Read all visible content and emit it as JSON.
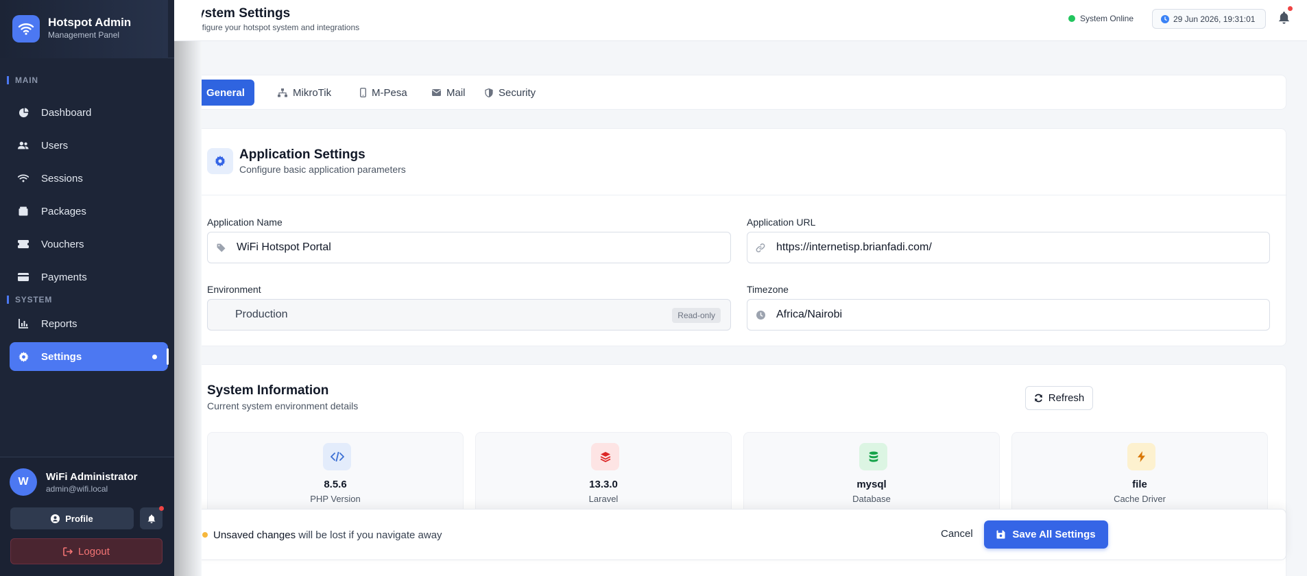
{
  "brand": {
    "title": "Hotspot Admin",
    "subtitle": "Management Panel"
  },
  "sidebar": {
    "sections": {
      "main": "MAIN",
      "system": "SYSTEM"
    },
    "items": [
      {
        "label": "Dashboard",
        "icon": "dashboard-icon"
      },
      {
        "label": "Users",
        "icon": "users-icon"
      },
      {
        "label": "Sessions",
        "icon": "wifi-icon"
      },
      {
        "label": "Packages",
        "icon": "box-icon"
      },
      {
        "label": "Vouchers",
        "icon": "ticket-icon"
      },
      {
        "label": "Payments",
        "icon": "credit-card-icon"
      },
      {
        "label": "Reports",
        "icon": "chart-icon"
      },
      {
        "label": "Settings",
        "icon": "gear-icon",
        "active": true
      }
    ]
  },
  "user": {
    "initial": "W",
    "name": "WiFi Administrator",
    "email": "admin@wifi.local",
    "profile_label": "Profile",
    "logout_label": "Logout"
  },
  "header": {
    "title": "ystem Settings",
    "subtitle": "nfigure your hotspot system and integrations",
    "status": "System Online",
    "datetime": "29 Jun 2026, 19:31:01"
  },
  "tabs": [
    {
      "label": "General",
      "active": true
    },
    {
      "label": "MikroTik"
    },
    {
      "label": "M-Pesa"
    },
    {
      "label": "Mail"
    },
    {
      "label": "Security"
    }
  ],
  "app_settings": {
    "title": "Application Settings",
    "subtitle": "Configure basic application parameters",
    "fields": {
      "app_name": {
        "label": "Application Name",
        "value": "WiFi Hotspot Portal"
      },
      "app_url": {
        "label": "Application URL",
        "value": "https://internetisp.brianfadi.com/"
      },
      "environment": {
        "label": "Environment",
        "value": "Production",
        "badge": "Read-only"
      },
      "timezone": {
        "label": "Timezone",
        "value": "Africa/Nairobi"
      }
    }
  },
  "system_info": {
    "title": "System Information",
    "subtitle": "Current system environment details",
    "refresh_label": "Refresh",
    "cards": [
      {
        "value": "8.5.6",
        "label": "PHP Version",
        "icon": "code-icon",
        "color": "#3b6fd4",
        "bg": "#e3ecfb"
      },
      {
        "value": "13.3.0",
        "label": "Laravel",
        "icon": "layers-icon",
        "color": "#dc2626",
        "bg": "#fde4e4"
      },
      {
        "value": "mysql",
        "label": "Database",
        "icon": "database-icon",
        "color": "#16a34a",
        "bg": "#dcf5e3"
      },
      {
        "value": "file",
        "label": "Cache Driver",
        "icon": "bolt-icon",
        "color": "#d97706",
        "bg": "#fdf1cf"
      }
    ]
  },
  "savebar": {
    "warning_bold": "Unsaved changes",
    "warning_rest": " will be lost if you navigate away",
    "cancel_label": "Cancel",
    "save_label": "Save All Settings"
  }
}
